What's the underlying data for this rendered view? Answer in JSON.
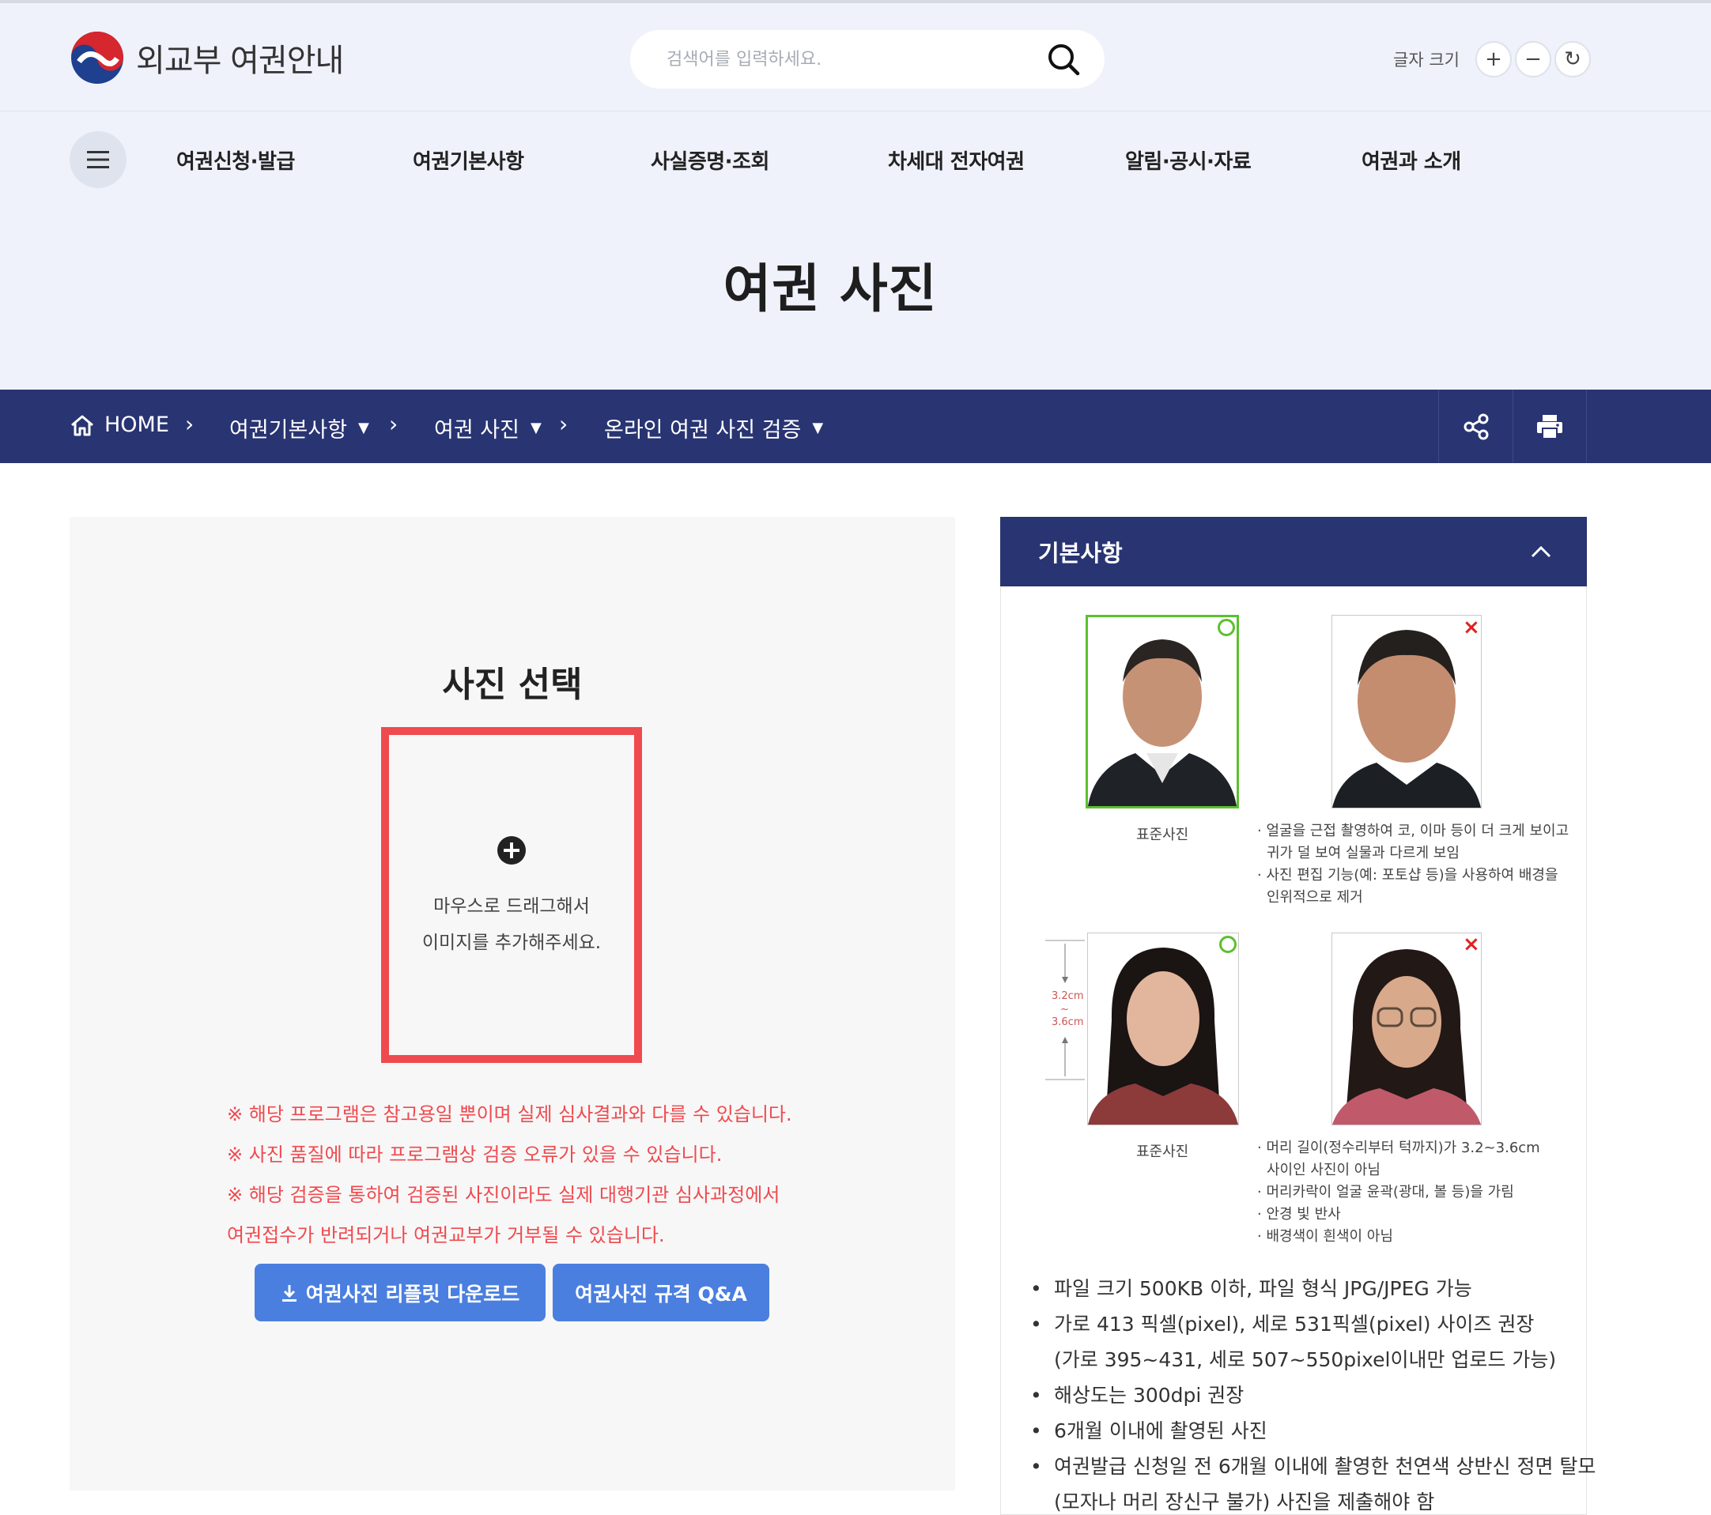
{
  "header": {
    "logo_text": "외교부 여권안내",
    "search_placeholder": "검색어를 입력하세요.",
    "fontsize_label": "글자 크기",
    "fontsize_plus": "+",
    "fontsize_minus": "−",
    "fontsize_reset": "↻"
  },
  "nav": {
    "items": [
      "여권신청·발급",
      "여권기본사항",
      "사실증명·조회",
      "차세대 전자여권",
      "알림·공시·자료",
      "여권과 소개"
    ]
  },
  "page_title": "여권 사진",
  "breadcrumb": {
    "home": "HOME",
    "items": [
      "여권기본사항",
      "여권 사진",
      "온라인 여권 사진 검증"
    ],
    "separator": "›",
    "caret": "▼"
  },
  "upload": {
    "title": "사진 선택",
    "drop_line1": "마우스로 드래그해서",
    "drop_line2": "이미지를 추가해주세요.",
    "notices": [
      "※ 해당 프로그램은 참고용일 뿐이며 실제 심사결과와 다를 수 있습니다.",
      "※ 사진 품질에 따라 프로그램상 검증 오류가 있을 수 있습니다.",
      "※ 해당 검증을 통하여 검증된 사진이라도 실제 대행기관 심사과정에서",
      "여권접수가 반려되거나 여권교부가 거부될 수 있습니다."
    ],
    "btn_download": "여권사진 리플릿 다운로드",
    "btn_qa": "여권사진 규격 Q&A"
  },
  "basics": {
    "title": "기본사항",
    "standard_caption": "표준사진",
    "male_notes": [
      "· 얼굴을 근접 촬영하여 코, 이마 등이 더 크게 보이고",
      "귀가 덜 보여 실물과 다르게 보임",
      "· 사진 편집 기능(예: 포토샵 등)을 사용하여 배경을",
      "인위적으로 제거"
    ],
    "female_notes": [
      "· 머리 길이(정수리부터 턱까지)가 3.2~3.6cm",
      "사이인 사진이 아님",
      "· 머리카락이 얼굴 윤곽(광대, 볼 등)을 가림",
      "· 안경 빛 반사",
      "· 배경색이 흰색이 아님"
    ],
    "measure_top": "3.2cm",
    "measure_mid": "~",
    "measure_bottom": "3.6cm",
    "bullet": "•",
    "info": [
      "파일 크기 500KB 이하, 파일 형식 JPG/JPEG 가능",
      "가로 413 픽셀(pixel), 세로 531픽셀(pixel) 사이즈 권장",
      "(가로 395~431, 세로 507~550pixel이내만 업로드 가능)",
      "해상도는 300dpi 권장",
      "6개월 이내에 촬영된 사진",
      "여권발급 신청일 전 6개월 이내에 촬영한 천연색 상반신 정면 탈모",
      "(모자나 머리 장신구 불가) 사진을 제출해야 함"
    ]
  },
  "colors": {
    "navy": "#293472",
    "accent_red": "#ef4a4f",
    "button_blue": "#4a7fe0",
    "band": "#eff2fb"
  }
}
